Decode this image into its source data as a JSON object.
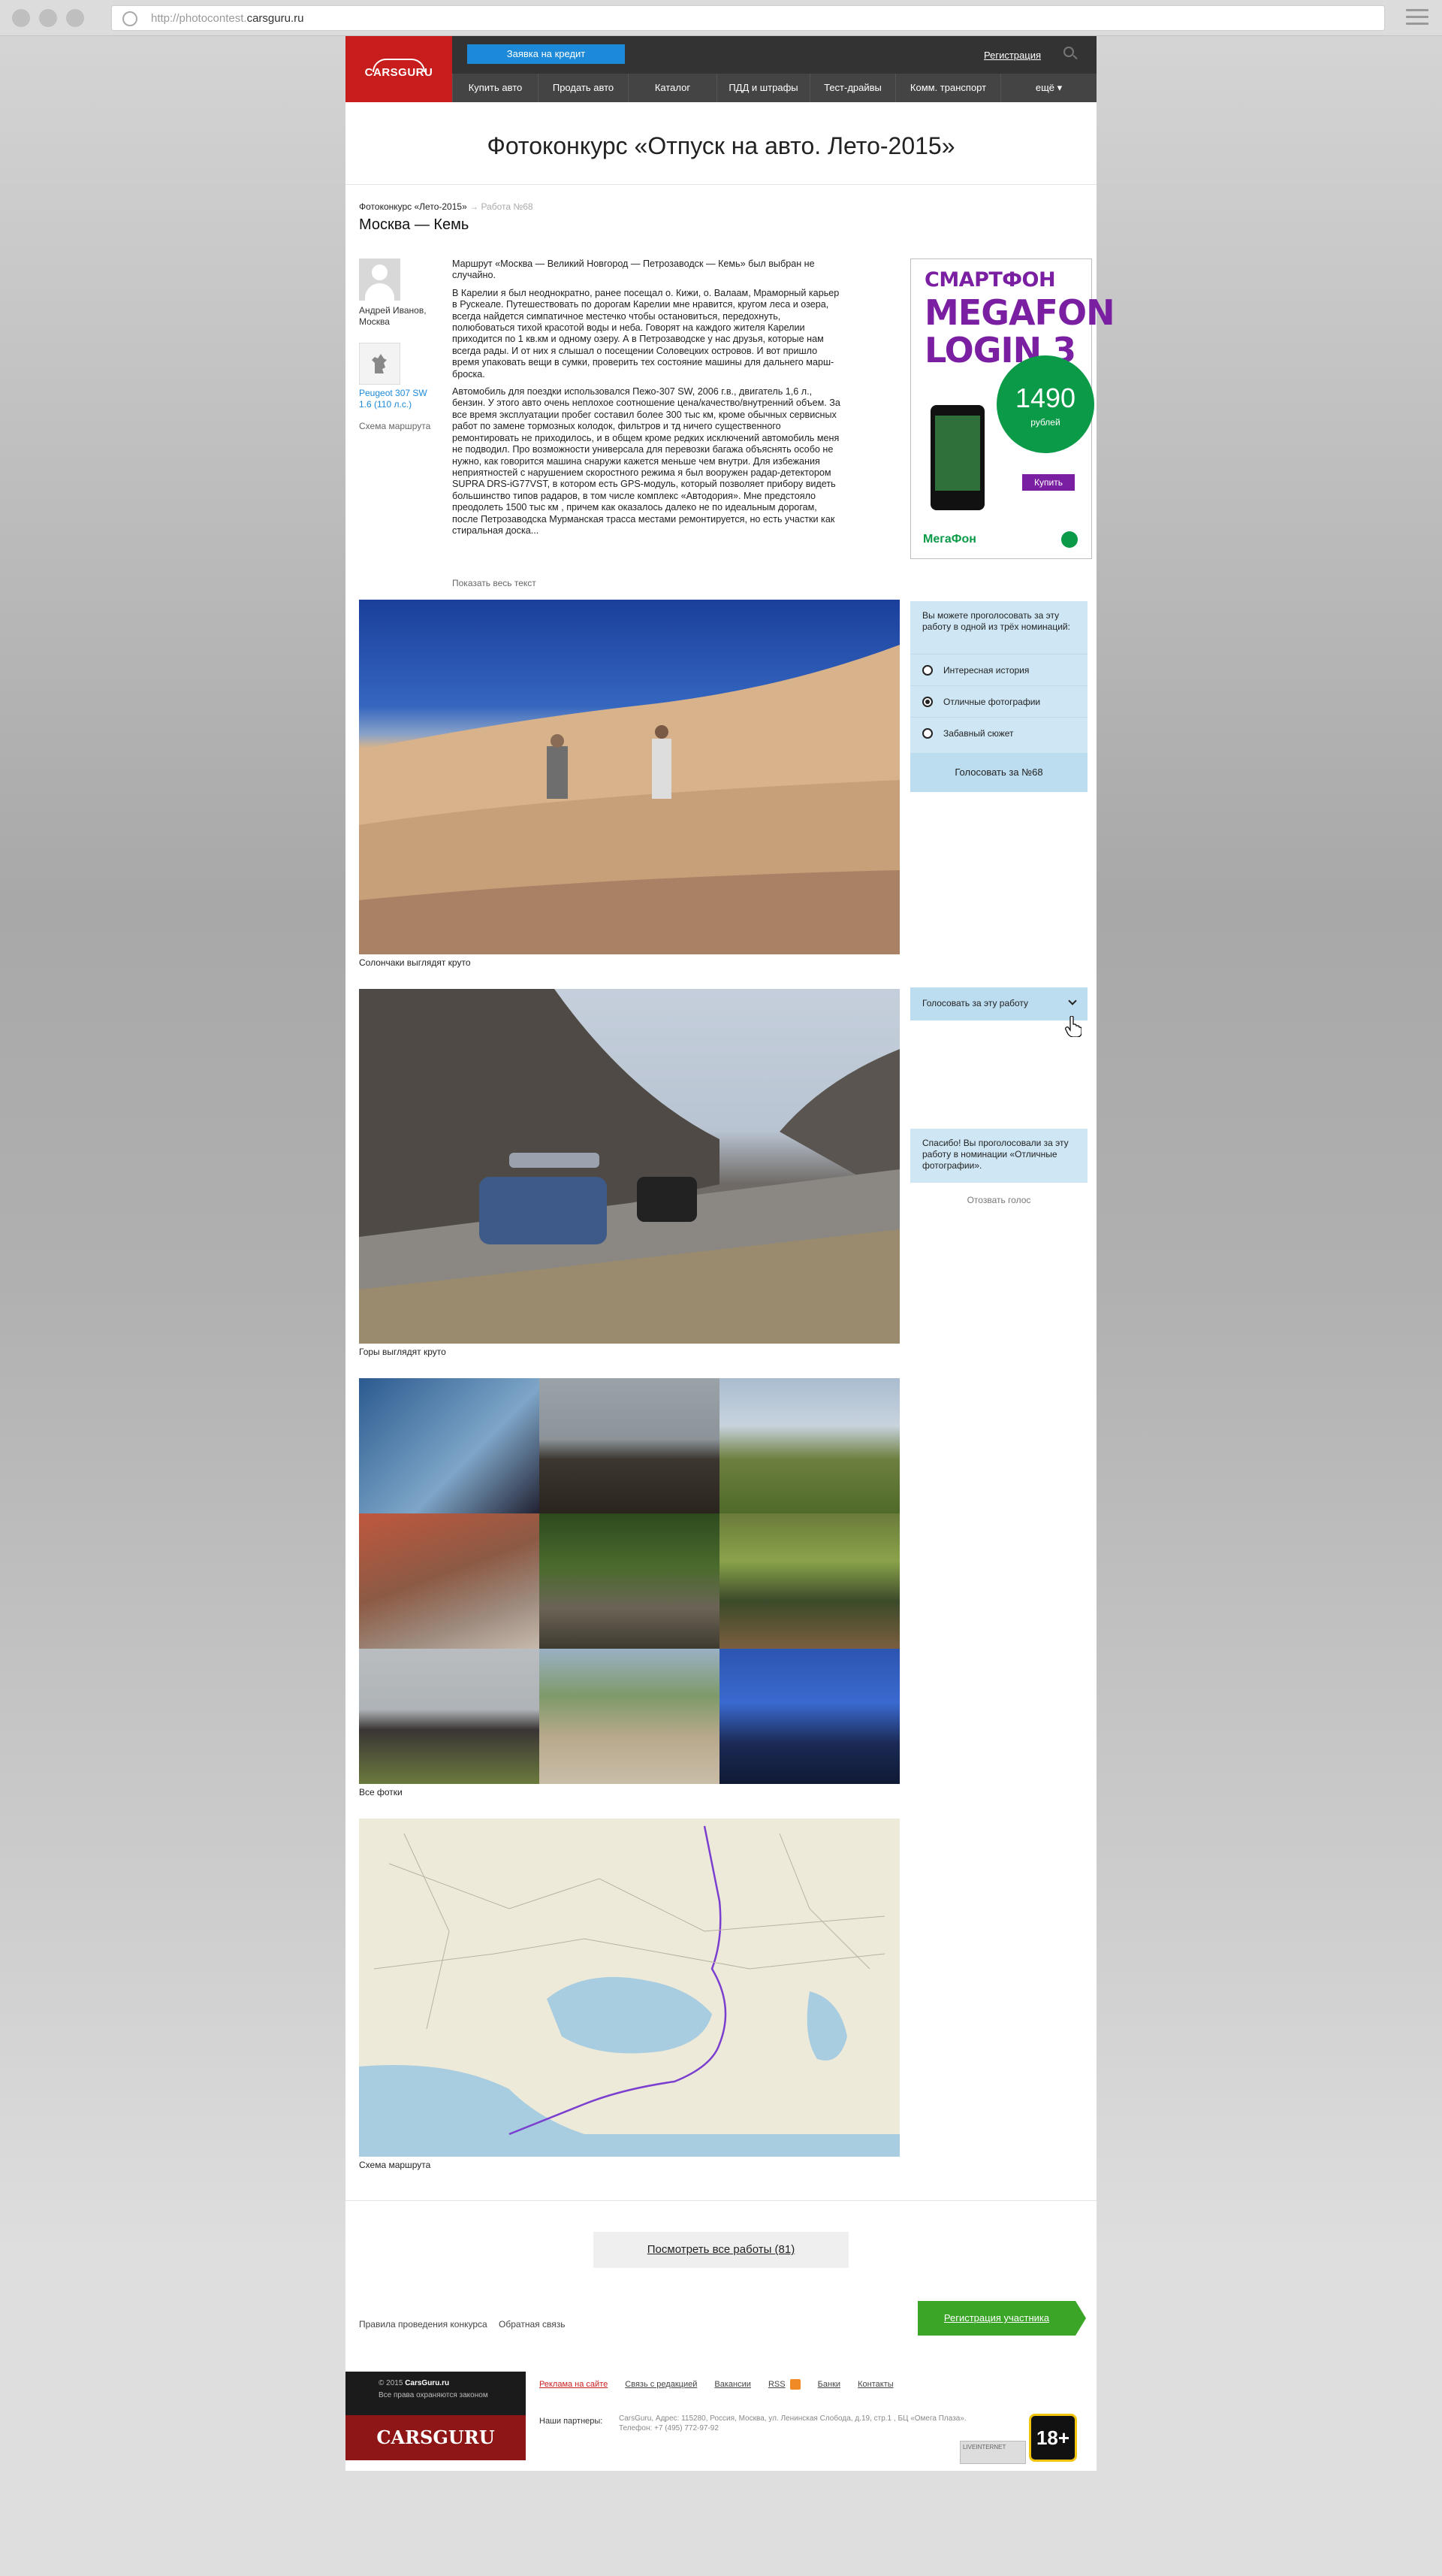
{
  "browser": {
    "url_prefix": "http://photocontest.",
    "url_domain": "carsguru.ru"
  },
  "header": {
    "logo": "CARSGURU",
    "credit_button": "Заявка на кредит",
    "register": "Регистрация",
    "nav": [
      "Купить авто",
      "Продать авто",
      "Каталог",
      "ПДД и штрафы",
      "Тест-драйвы",
      "Комм. транспорт",
      "ещё ▾"
    ]
  },
  "page_title": "Фотоконкурс «Отпуск на авто. Лето-2015»",
  "breadcrumb": {
    "parent": "Фотоконкурс «Лето-2015»",
    "sep": "→",
    "current": "Работа №68"
  },
  "work_title": "Москва — Кемь",
  "author": {
    "name": "Андрей Иванов, Москва",
    "car": "Peugeot 307 SW 1.6 (110 л.с.)",
    "route_link": "Схема маршрута"
  },
  "story": [
    "Маршрут «Москва — Великий Новгород — Петрозаводск — Кемь» был выбран не случайно.",
    "В Карелии я был неоднократно, ранее посещал о. Кижи, о. Валаам, Мраморный карьер в Рускеале. Путешествовать по дорогам Карелии мне нравится, кругом леса и озера, всегда найдется симпатичное местечко чтобы остановиться, передохнуть, полюбоваться тихой красотой воды и неба. Говорят на каждого жителя Карелии приходится по 1 кв.км и одному озеру. А в Петрозаводске у нас друзья, которые нам всегда рады. И от них я слышал о посещении Соловецких островов. И вот пришло время упаковать вещи в сумки, проверить тех состояние машины для дальнего марш-броска.",
    "Автомобиль для поездки использовался Пежо-307 SW, 2006 г.в., двигатель 1,6 л., бензин. У этого авто очень неплохое соотношение цена/качество/внутренний объем. За все время эксплуатации пробег составил более 300 тыс км, кроме обычных сервисных работ по замене тормозных колодок, фильтров и тд ничего существенного ремонтировать не приходилось, и в общем кроме редких исключений автомобиль меня не подводил. Про возможности универсала для перевозки багажа объяснять особо не нужно, как говорится машина снаружи кажется меньше чем внутри. Для избежания неприятностей с нарушением скоростного режима я был вооружен радар-детектором SUPRA DRS-iG77VST, в котором есть GPS-модуль, который позволяет прибору видеть большинство типов радаров, в том числе комплекс «Автодория». Мне предстояло преодолеть 1500 тыс км , причем как оказалось далеко не по идеальным дорогам, после Петрозаводска Мурманская трасса местами ремонтируется, но есть участки как стиральная доска..."
  ],
  "show_all": "Показать весь текст",
  "ad": {
    "line1": "СМАРТФОН",
    "line2a": "MEGAFON",
    "line2b": "LOGIN 3",
    "price": "1490",
    "currency": "рублей",
    "buy": "Купить",
    "brand": "МегаФон"
  },
  "photos": {
    "caption1": "Солончаки выглядят круто",
    "caption2": "Горы выглядят круто",
    "caption_grid": "Все фотки",
    "caption_map": "Схема маршрута"
  },
  "vote": {
    "intro": "Вы можете проголосовать за эту работу в одной из трёх номинаций:",
    "options": [
      "Интересная история",
      "Отличные фотографии",
      "Забавный сюжет"
    ],
    "selected_index": 1,
    "button": "Голосовать за №68",
    "dropdown": "Голосовать за эту работу",
    "thanks": "Спасибо! Вы проголосовали за эту работу в номинации «Отличные фотографии».",
    "revoke": "Отозвать голос"
  },
  "all_works": "Посмотреть все работы (81)",
  "footer_links": {
    "rules": "Правила проведения конкурса",
    "feedback": "Обратная связь",
    "register_participant": "Регистрация участника"
  },
  "footer": {
    "copyright_year": "© 2015",
    "copyright_brand": "CarsGuru.ru",
    "rights": "Все права охраняются законом",
    "logo": "CARSGURU",
    "nav": [
      "Реклама на сайте",
      "Связь с редакцией",
      "Вакансии",
      "RSS",
      "Банки",
      "Контакты"
    ],
    "partners": "Наши партнеры:",
    "address": "CarsGuru, Адрес: 115280, Россия, Москва, ул. Ленинская Слобода, д.19, стр.1 , БЦ «Омега Плаза».",
    "phone": "Телефон: +7 (495) 772-97-92",
    "counter": "LIVEINTERNET",
    "age": "18+"
  },
  "colors": {
    "brand_red": "#c81d1d",
    "credit_blue": "#1c8ad8",
    "vote_blue": "#cfe7f4",
    "register_green": "#3aa526",
    "megafon_purple": "#7a1fa2",
    "megafon_green": "#0b9a48"
  }
}
